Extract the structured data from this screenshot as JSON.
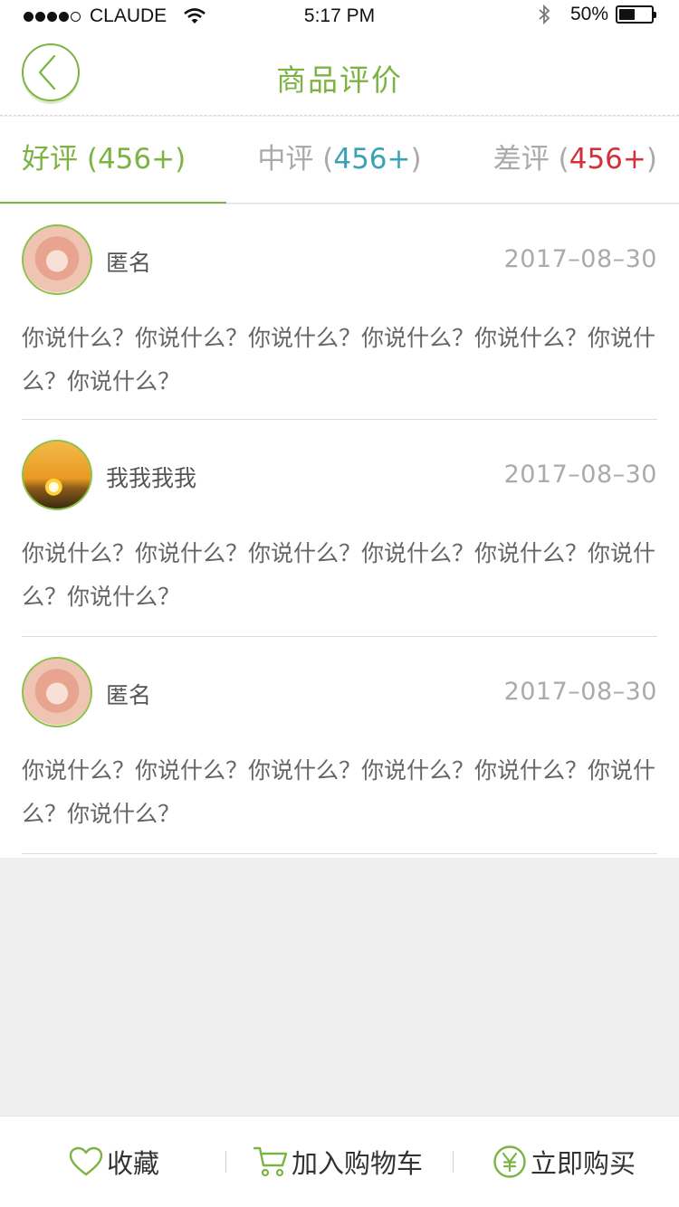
{
  "status_bar": {
    "carrier": "CLAUDE",
    "time": "5:17 PM",
    "battery": "50%",
    "battery_level": 0.5
  },
  "header": {
    "title": "商品评价",
    "back_icon": "chevron-left-icon"
  },
  "tabs": [
    {
      "label": "好评",
      "count": "(456+)",
      "active": true
    },
    {
      "label": "中评",
      "count": "456+",
      "open": "(",
      "close": ")"
    },
    {
      "label": "差评",
      "count": "456+",
      "open": "(",
      "close": ")"
    }
  ],
  "reviews": [
    {
      "name": "匿名",
      "date": "2017–08–30",
      "text": "你说什么？你说什么？你说什么？你说什么？你说什么？你说什么？你说什么？",
      "avatar": "girl"
    },
    {
      "name": "我我我我",
      "date": "2017–08–30",
      "text": "你说什么？你说什么？你说什么？你说什么？你说什么？你说什么？你说什么？",
      "avatar": "sunset"
    },
    {
      "name": "匿名",
      "date": "2017–08–30",
      "text": "你说什么？你说什么？你说什么？你说什么？你说什么？你说什么？你说什么？",
      "avatar": "girl"
    }
  ],
  "bottom_bar": {
    "favorite": "收藏",
    "add_to_cart": "加入购物车",
    "buy_now": "立即购买"
  },
  "colors": {
    "accent": "#7cb342",
    "mid": "#3aa2b6",
    "bad": "#d4303c"
  }
}
